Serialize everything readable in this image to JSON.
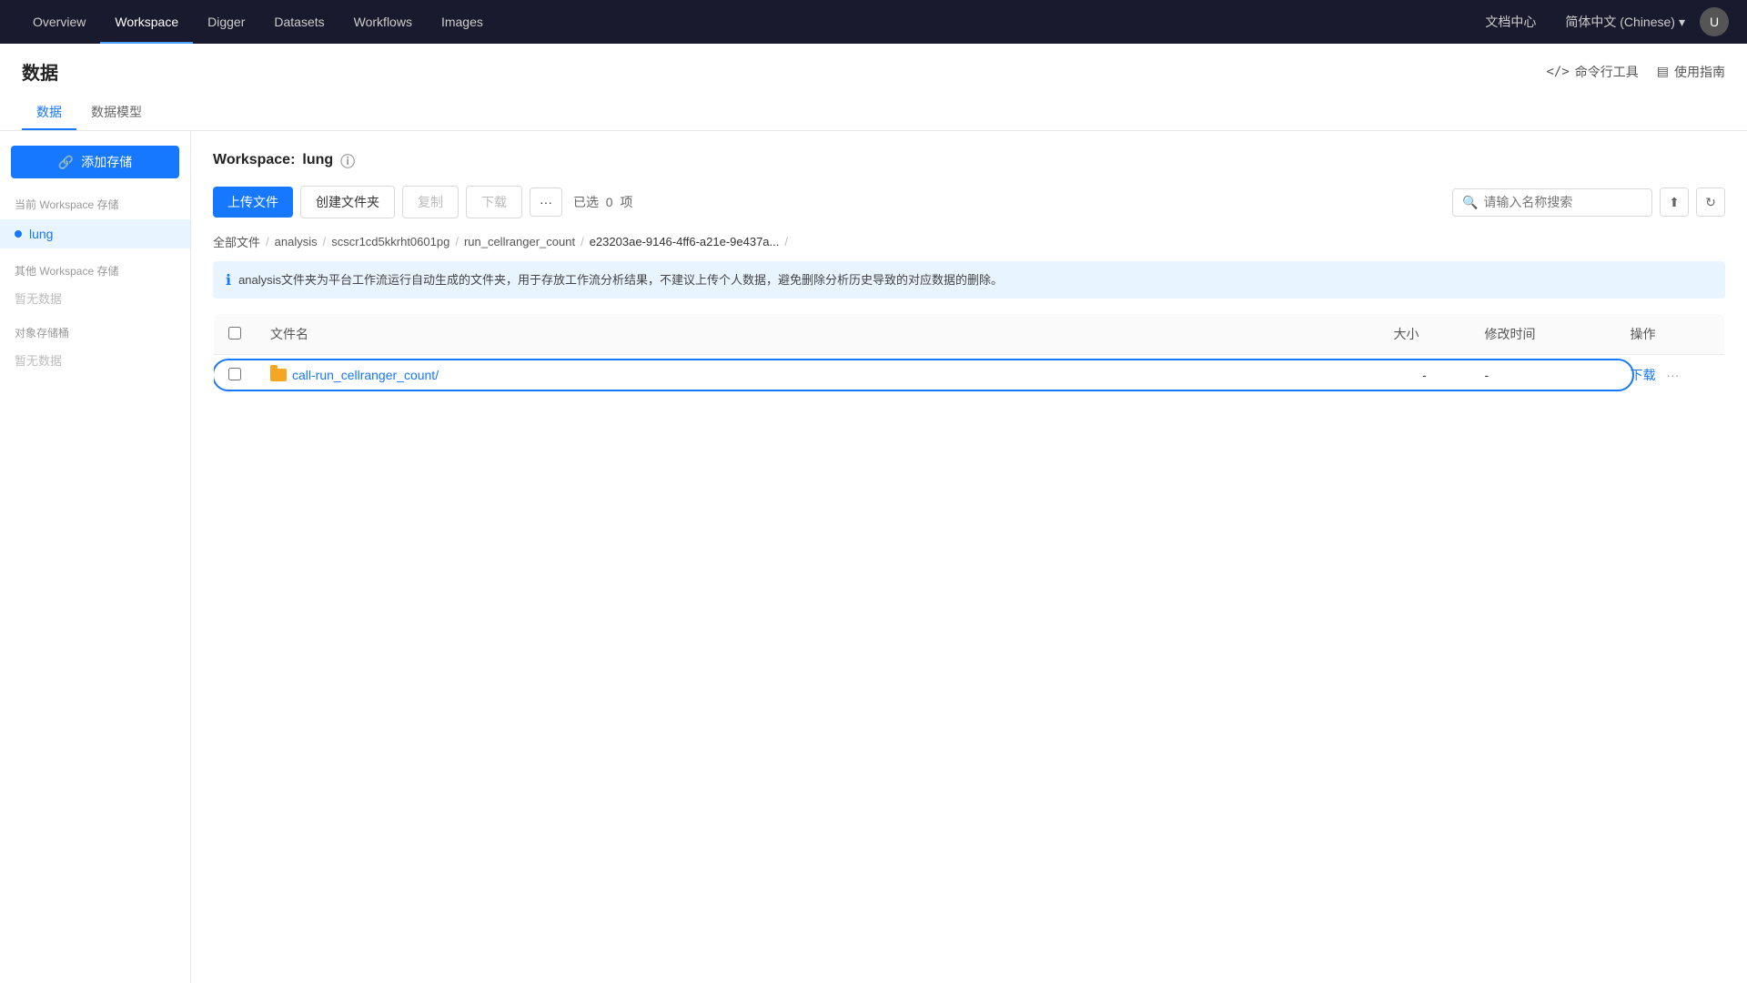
{
  "nav": {
    "items": [
      {
        "label": "Overview",
        "active": false
      },
      {
        "label": "Workspace",
        "active": true
      },
      {
        "label": "Digger",
        "active": false
      },
      {
        "label": "Datasets",
        "active": false
      },
      {
        "label": "Workflows",
        "active": false
      },
      {
        "label": "Images",
        "active": false
      }
    ],
    "docs_label": "文档中心",
    "lang_label": "简体中文 (Chinese)",
    "lang_arrow": "▾"
  },
  "page": {
    "title": "数据",
    "tabs": [
      {
        "label": "数据",
        "active": true
      },
      {
        "label": "数据模型",
        "active": false
      }
    ],
    "header_actions": [
      {
        "label": "命令行工具",
        "icon": "</>"
      },
      {
        "label": "使用指南",
        "icon": "▤"
      }
    ]
  },
  "sidebar": {
    "add_btn_label": "添加存储",
    "current_section": "当前 Workspace 存储",
    "current_items": [
      {
        "label": "lung",
        "active": true
      }
    ],
    "other_section": "其他 Workspace 存储",
    "other_empty": "暂无数据",
    "object_section": "对象存储桶",
    "object_empty": "暂无数据"
  },
  "workspace": {
    "title": "Workspace:",
    "name": "lung",
    "help_icon": "?"
  },
  "toolbar": {
    "upload_label": "上传文件",
    "create_folder_label": "创建文件夹",
    "copy_label": "复制",
    "download_label": "下载",
    "more_label": "···",
    "selected_prefix": "已选",
    "selected_count": "0",
    "selected_suffix": "项",
    "search_placeholder": "请输入名称搜索"
  },
  "breadcrumb": {
    "items": [
      {
        "label": "全部文件",
        "sep": "/"
      },
      {
        "label": "analysis",
        "sep": "/"
      },
      {
        "label": "scscr1cd5kkrht0601pg",
        "sep": "/"
      },
      {
        "label": "run_cellranger_count",
        "sep": "/"
      },
      {
        "label": "e23203ae-9146-4ff6-a21e-9e437a...",
        "sep": "/"
      }
    ]
  },
  "info_banner": {
    "text": "analysis文件夹为平台工作流运行自动生成的文件夹，用于存放工作流分析结果，不建议上传个人数据，避免删除分析历史导致的对应数据的删除。"
  },
  "table": {
    "columns": [
      {
        "label": "文件名"
      },
      {
        "label": "大小"
      },
      {
        "label": "修改时间"
      },
      {
        "label": "操作"
      }
    ],
    "rows": [
      {
        "name": "call-run_cellranger_count/",
        "is_folder": true,
        "size": "-",
        "time": "-",
        "action_download": "下载",
        "action_more": "···",
        "highlighted": true
      }
    ]
  }
}
